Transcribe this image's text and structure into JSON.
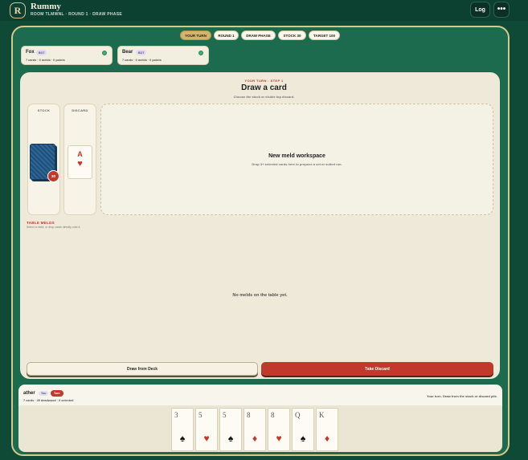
{
  "app": {
    "logo_letter": "R",
    "title": "Rummy",
    "room_info": "ROOM TLMWNL · ROUND 1 · DRAW PHASE",
    "log_label": "Log",
    "more_label": "•••"
  },
  "status_pills": [
    "YOUR TURN",
    "ROUND 1",
    "DRAW PHASE",
    "STOCK 30",
    "TARGET 100"
  ],
  "opponents": [
    {
      "name": "Fox",
      "badge": "BOT",
      "stats": "7 cards · 0 melds · 0 points"
    },
    {
      "name": "Bear",
      "badge": "BOT",
      "stats": "7 cards · 0 melds · 0 points"
    }
  ],
  "step": {
    "kicker": "YOUR TURN · STEP 1",
    "title": "Draw a card",
    "hint": "Choose the stock or visible top discard."
  },
  "stock": {
    "label": "STOCK",
    "count": "30"
  },
  "discard": {
    "label": "DISCARD",
    "rank": "A",
    "suit": "♥"
  },
  "workspace": {
    "title": "New meld workspace",
    "hint": "Drop 3+ selected cards here to propose a set or suited run."
  },
  "table_melds": {
    "title": "TABLE MELDS",
    "hint": "Select a meld, or drop cards directly onto it.",
    "empty": "No melds on the table yet."
  },
  "actions": {
    "draw_label": "Draw from Deck",
    "take_label": "Take Discard"
  },
  "player": {
    "name": "ather",
    "you_badge": "You",
    "turn_badge": "Turn",
    "stats": "7 cards · 49 deadwood · 0 selected",
    "message": "Your turn. Draw from the stock or discard pile."
  },
  "hand_cards": [
    {
      "rank": "3",
      "suit": "♠",
      "color": "#111111"
    },
    {
      "rank": "5",
      "suit": "♥",
      "color": "#c0392b"
    },
    {
      "rank": "5",
      "suit": "♠",
      "color": "#111111"
    },
    {
      "rank": "8",
      "suit": "♦",
      "color": "#c0392b"
    },
    {
      "rank": "8",
      "suit": "♥",
      "color": "#c0392b"
    },
    {
      "rank": "Q",
      "suit": "♠",
      "color": "#111111"
    },
    {
      "rank": "K",
      "suit": "♦",
      "color": "#c0392b"
    }
  ],
  "colors": {
    "felt": "#1d6b4e",
    "accent_red": "#c0392b",
    "gold_border": "#d8c88c"
  }
}
